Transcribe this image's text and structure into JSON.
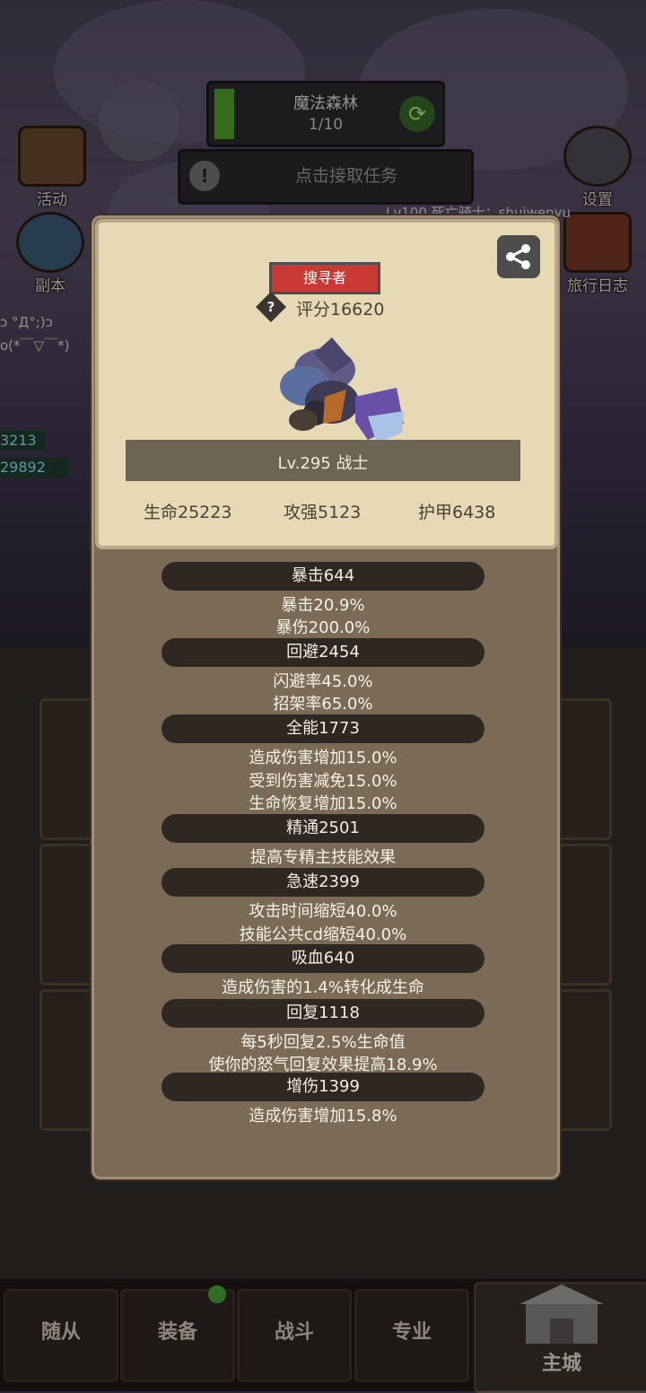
{
  "hud": {
    "map_name": "魔法森林",
    "map_progress_text": "1/10",
    "map_progress": 0.1,
    "quest_label": "点击接取任务",
    "activity_label": "活动",
    "dungeon_label": "副本",
    "settings_label": "设置",
    "journal_label": "旅行日志",
    "chat_line1": "Lv100 死亡骑士：shuiwenyu",
    "chat_line2": "ɔ °Д°;)ɔ",
    "chat_line3": "o(*￣▽￣*)",
    "tag1": "3213",
    "tag2": "29892"
  },
  "nav": {
    "tab1": "随从",
    "tab2": "装备",
    "tab3": "战斗",
    "tab4": "专业",
    "main_city": "主城"
  },
  "panel": {
    "title_badge": "搜寻者",
    "score_icon": "?",
    "score": "评分16620",
    "level": "Lv.295 战士",
    "hp": "生命25223",
    "attack": "攻强5123",
    "armor": "护甲6438",
    "stats": [
      {
        "head": "暴击644",
        "lines": [
          "暴击20.9%",
          "暴伤200.0%"
        ]
      },
      {
        "head": "回避2454",
        "lines": [
          "闪避率45.0%",
          "招架率65.0%"
        ]
      },
      {
        "head": "全能1773",
        "lines": [
          "造成伤害增加15.0%",
          "受到伤害减免15.0%",
          "生命恢复增加15.0%"
        ]
      },
      {
        "head": "精通2501",
        "lines": [
          "提高专精主技能效果"
        ]
      },
      {
        "head": "急速2399",
        "lines": [
          "攻击时间缩短40.0%",
          "技能公共cd缩短40.0%"
        ]
      },
      {
        "head": "吸血640",
        "lines": [
          "造成伤害的1.4%转化成生命"
        ]
      },
      {
        "head": "回复1118",
        "lines": [
          "每5秒回复2.5%生命值",
          "使你的怒气回复效果提高18.9%"
        ]
      },
      {
        "head": "增伤1399",
        "lines": [
          "造成伤害增加15.8%"
        ]
      }
    ]
  }
}
